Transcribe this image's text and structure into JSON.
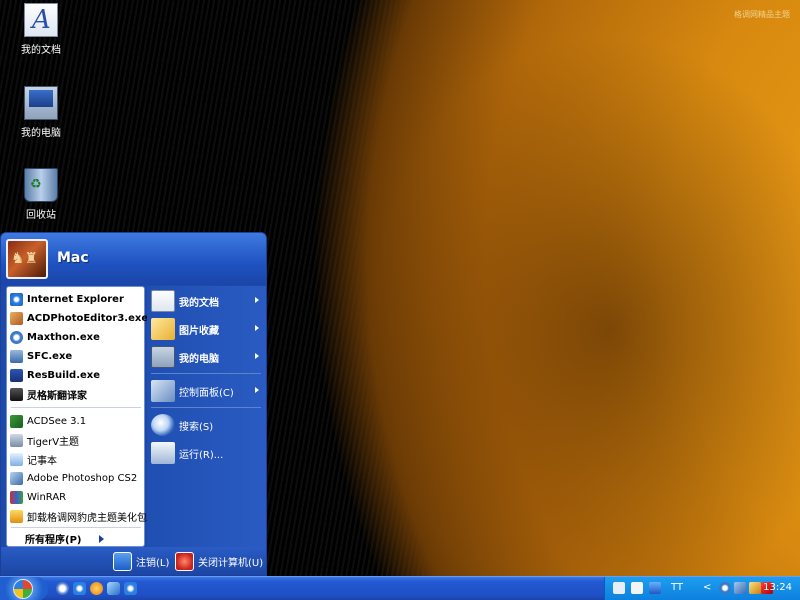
{
  "watermark": "格调网精品主题",
  "desktop_icons": [
    {
      "label": "我的文档",
      "icon": "my-documents-icon"
    },
    {
      "label": "我的电脑",
      "icon": "my-computer-icon"
    },
    {
      "label": "回收站",
      "icon": "recycle-bin-icon"
    }
  ],
  "start_menu": {
    "user_name": "Mac",
    "pinned": [
      {
        "label": "Internet Explorer",
        "icon": "ie-icon"
      },
      {
        "label": "ACDPhotoEditor3.exe",
        "icon": "acd-photo-editor-icon"
      },
      {
        "label": "Maxthon.exe",
        "icon": "maxthon-icon"
      },
      {
        "label": "SFC.exe",
        "icon": "sfc-icon"
      },
      {
        "label": "ResBuild.exe",
        "icon": "resbuild-icon"
      },
      {
        "label": "灵格斯翻译家",
        "icon": "lingoes-icon"
      }
    ],
    "recent": [
      {
        "label": "ACDSee 3.1",
        "icon": "acdsee-icon"
      },
      {
        "label": "TigerV主题",
        "icon": "tigerv-icon"
      },
      {
        "label": "记事本",
        "icon": "notepad-icon"
      },
      {
        "label": "Adobe Photoshop CS2",
        "icon": "photoshop-icon"
      },
      {
        "label": "WinRAR",
        "icon": "winrar-icon"
      },
      {
        "label": "卸载格调网豹虎主题美化包",
        "icon": "uninstall-icon"
      }
    ],
    "all_programs": "所有程序(P)",
    "right_items": [
      {
        "label": "我的文档",
        "icon": "my-documents-icon",
        "submenu": true
      },
      {
        "label": "图片收藏",
        "icon": "my-pictures-icon",
        "submenu": true
      },
      {
        "label": "我的电脑",
        "icon": "my-computer-icon",
        "submenu": true
      },
      {
        "label": "控制面板(C)",
        "icon": "control-panel-icon",
        "submenu": true
      },
      {
        "label": "搜索(S)",
        "icon": "search-icon",
        "submenu": false
      },
      {
        "label": "运行(R)...",
        "icon": "run-icon",
        "submenu": false
      }
    ],
    "logoff": "注销(L)",
    "shutdown": "关闭计算机(U)"
  },
  "taskbar": {
    "quick_launch": [
      "show-desktop-icon",
      "ie-icon",
      "messenger-icon",
      "media-icon",
      "ie-icon"
    ],
    "tray_text": "TT",
    "clock": "13:24"
  },
  "colors": {
    "start_menu_blue": "#1d4aa8",
    "taskbar_blue": "#2359d2",
    "tray_blue": "#0d7fde"
  }
}
